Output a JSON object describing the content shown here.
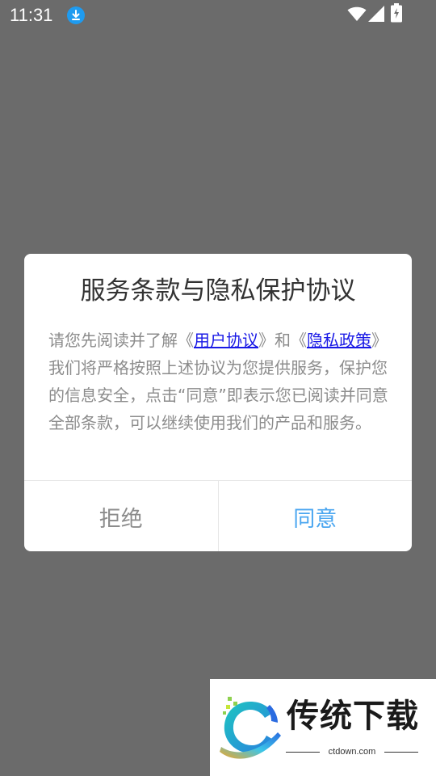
{
  "status_bar": {
    "time": "11:31",
    "icons": [
      "download-icon",
      "wifi-icon",
      "cell-signal-icon",
      "battery-charging-icon"
    ]
  },
  "dialog": {
    "title": "服务条款与隐私保护协议",
    "body": {
      "text_1": "请您先阅读并了解《",
      "link_user_agreement": "用户协议",
      "text_2": "》和《",
      "link_privacy_policy": "隐私政策",
      "text_3": "》我们将严格按照上述协议为您提供服务，保护您的信息安全，点击“同意”即表示您已阅读并同意全部条款，可以继续使用我们的产品和服务。"
    },
    "reject_label": "拒绝",
    "agree_label": "同意"
  },
  "watermark": {
    "brand": "传统下载",
    "domain": "ctdown.com"
  },
  "colors": {
    "overlay": "#6b6b6b",
    "link": "#1a1ae6",
    "agree": "#4aa6f0",
    "muted_text": "#8c8c8c",
    "status_icon_blue": "#1e9bf0"
  }
}
